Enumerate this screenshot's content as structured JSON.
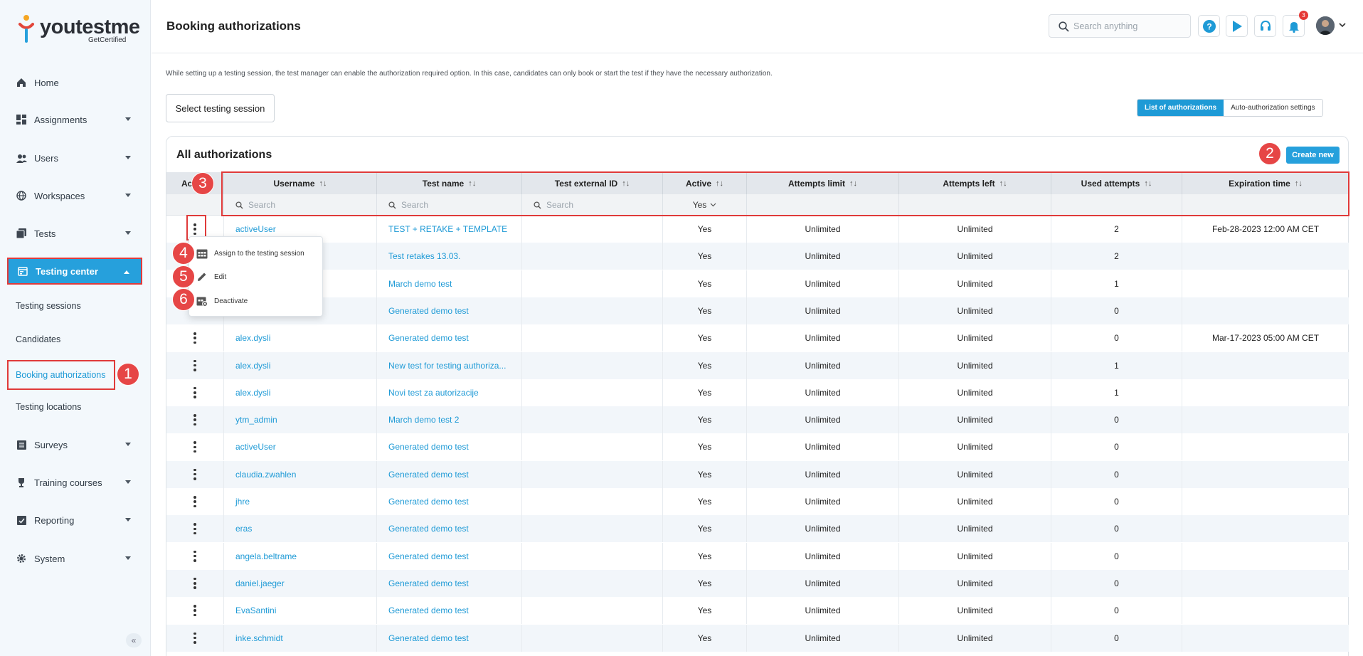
{
  "brand": {
    "name_part1": "you",
    "name_part2": "test",
    "name_part3": "me",
    "tagline": "GetCertified"
  },
  "sidebar": {
    "items": [
      {
        "label": "Home",
        "icon": "home-icon"
      },
      {
        "label": "Assignments",
        "icon": "dashboard-icon"
      },
      {
        "label": "Users",
        "icon": "users-icon"
      },
      {
        "label": "Workspaces",
        "icon": "globe-icon"
      },
      {
        "label": "Tests",
        "icon": "tests-icon"
      },
      {
        "label": "Testing center",
        "icon": "calendar-icon"
      },
      {
        "label": "Surveys",
        "icon": "list-icon"
      },
      {
        "label": "Training courses",
        "icon": "trophy-icon"
      },
      {
        "label": "Reporting",
        "icon": "report-icon"
      },
      {
        "label": "System",
        "icon": "gear-icon"
      }
    ],
    "subitems": [
      "Testing sessions",
      "Candidates",
      "Booking authorizations",
      "Testing locations"
    ]
  },
  "header": {
    "title": "Booking authorizations",
    "search_placeholder": "Search anything",
    "notifications_count": "3"
  },
  "intro_text": "While setting up a testing session, the test manager can enable the authorization required option. In this case, candidates can only book or start the test if they have the necessary authorization.",
  "select_session_label": "Select testing session",
  "view_toggle": {
    "list": "List of authorizations",
    "auto": "Auto-authorization settings"
  },
  "card": {
    "title": "All authorizations",
    "create_label": "Create new"
  },
  "table": {
    "columns": {
      "actions": "Act",
      "username": "Username",
      "test_name": "Test name",
      "external_id": "Test external ID",
      "active": "Active",
      "attempts_limit": "Attempts limit",
      "attempts_left": "Attempts left",
      "used_attempts": "Used attempts",
      "expiration": "Expiration time"
    },
    "sort_glyph": "↑↓",
    "filter_placeholder": "Search",
    "active_filter": "Yes",
    "rows": [
      {
        "user": "activeUser",
        "test": "TEST + RETAKE + TEMPLATE",
        "ext": "",
        "active": "Yes",
        "limit": "Unlimited",
        "left": "Unlimited",
        "used": "2",
        "exp": "Feb-28-2023 12:00 AM CET"
      },
      {
        "user": "",
        "test": "Test retakes 13.03.",
        "ext": "",
        "active": "Yes",
        "limit": "Unlimited",
        "left": "Unlimited",
        "used": "2",
        "exp": ""
      },
      {
        "user": "",
        "test": "March demo test",
        "ext": "",
        "active": "Yes",
        "limit": "Unlimited",
        "left": "Unlimited",
        "used": "1",
        "exp": ""
      },
      {
        "user": "",
        "test": "Generated demo test",
        "ext": "",
        "active": "Yes",
        "limit": "Unlimited",
        "left": "Unlimited",
        "used": "0",
        "exp": ""
      },
      {
        "user": "alex.dysli",
        "test": "Generated demo test",
        "ext": "",
        "active": "Yes",
        "limit": "Unlimited",
        "left": "Unlimited",
        "used": "0",
        "exp": "Mar-17-2023 05:00 AM CET"
      },
      {
        "user": "alex.dysli",
        "test": "New test for testing authoriza...",
        "ext": "",
        "active": "Yes",
        "limit": "Unlimited",
        "left": "Unlimited",
        "used": "1",
        "exp": ""
      },
      {
        "user": "alex.dysli",
        "test": "Novi test za autorizacije",
        "ext": "",
        "active": "Yes",
        "limit": "Unlimited",
        "left": "Unlimited",
        "used": "1",
        "exp": ""
      },
      {
        "user": "ytm_admin",
        "test": "March demo test 2",
        "ext": "",
        "active": "Yes",
        "limit": "Unlimited",
        "left": "Unlimited",
        "used": "0",
        "exp": ""
      },
      {
        "user": "activeUser",
        "test": "Generated demo test",
        "ext": "",
        "active": "Yes",
        "limit": "Unlimited",
        "left": "Unlimited",
        "used": "0",
        "exp": ""
      },
      {
        "user": "claudia.zwahlen",
        "test": "Generated demo test",
        "ext": "",
        "active": "Yes",
        "limit": "Unlimited",
        "left": "Unlimited",
        "used": "0",
        "exp": ""
      },
      {
        "user": "jhre",
        "test": "Generated demo test",
        "ext": "",
        "active": "Yes",
        "limit": "Unlimited",
        "left": "Unlimited",
        "used": "0",
        "exp": ""
      },
      {
        "user": "eras",
        "test": "Generated demo test",
        "ext": "",
        "active": "Yes",
        "limit": "Unlimited",
        "left": "Unlimited",
        "used": "0",
        "exp": ""
      },
      {
        "user": "angela.beltrame",
        "test": "Generated demo test",
        "ext": "",
        "active": "Yes",
        "limit": "Unlimited",
        "left": "Unlimited",
        "used": "0",
        "exp": ""
      },
      {
        "user": "daniel.jaeger",
        "test": "Generated demo test",
        "ext": "",
        "active": "Yes",
        "limit": "Unlimited",
        "left": "Unlimited",
        "used": "0",
        "exp": ""
      },
      {
        "user": "EvaSantini",
        "test": "Generated demo test",
        "ext": "",
        "active": "Yes",
        "limit": "Unlimited",
        "left": "Unlimited",
        "used": "0",
        "exp": ""
      },
      {
        "user": "inke.schmidt",
        "test": "Generated demo test",
        "ext": "",
        "active": "Yes",
        "limit": "Unlimited",
        "left": "Unlimited",
        "used": "0",
        "exp": ""
      }
    ]
  },
  "context_menu": {
    "items": [
      {
        "label": "Assign to the testing session",
        "icon": "calendar-grid-icon"
      },
      {
        "label": "Edit",
        "icon": "pencil-icon"
      },
      {
        "label": "Deactivate",
        "icon": "calendar-x-icon"
      }
    ]
  },
  "annotations": [
    "1",
    "2",
    "3",
    "4",
    "5",
    "6"
  ],
  "colors": {
    "accent": "#1e9ad6",
    "button": "#26a0dc",
    "annotation": "#e03a3a",
    "badge": "#e53935"
  }
}
